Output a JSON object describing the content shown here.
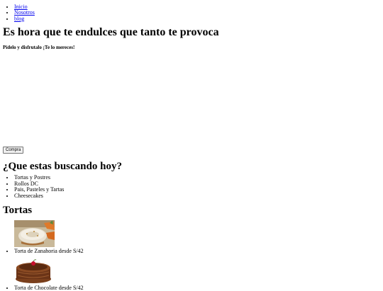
{
  "nav": {
    "items": [
      {
        "label": "Inicio"
      },
      {
        "label": "Nosotros"
      },
      {
        "label": "blog"
      }
    ]
  },
  "hero": {
    "title": "Es hora que te endulces que tanto te provoca",
    "subtitle": "Pídelo y disfrutalo ¡Te lo mereces!",
    "button_label": "Compra"
  },
  "categories": {
    "heading": "¿Que estas buscando hoy?",
    "items": [
      "Tortas y Postres",
      "Rollos DC",
      "Pais, Pasteles y Tartas",
      "Cheesecakes"
    ]
  },
  "tortas": {
    "heading": "Tortas",
    "products": [
      {
        "label": "Torta de Zanahoria desde S/42",
        "image": "carrot-cake-image"
      },
      {
        "label": "Torta de Chocolate desde S/42",
        "image": "chocolate-cake-image"
      }
    ]
  }
}
